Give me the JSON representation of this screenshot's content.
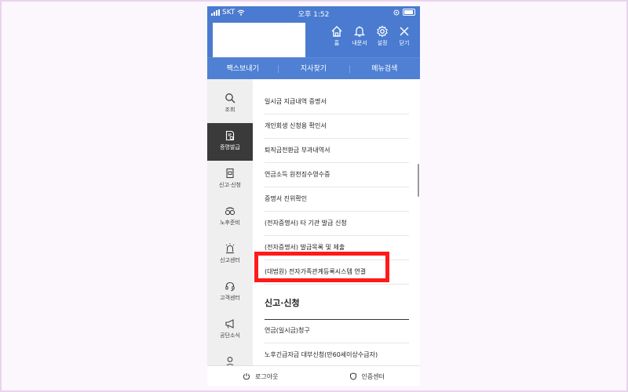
{
  "status_bar": {
    "carrier": "SKT",
    "time": "오후 1:52"
  },
  "header": {
    "buttons": [
      {
        "icon": "home-icon",
        "label": "홈"
      },
      {
        "icon": "bell-icon",
        "label": "내문서"
      },
      {
        "icon": "gear-icon",
        "label": "설정"
      },
      {
        "icon": "close-icon",
        "label": "닫기"
      }
    ]
  },
  "subnav": {
    "tabs": [
      "팩스보내기",
      "지사찾기",
      "메뉴검색"
    ]
  },
  "sidebar": {
    "items": [
      {
        "icon": "search-icon",
        "label": "조회"
      },
      {
        "icon": "certificate-icon",
        "label": "증명발급"
      },
      {
        "icon": "document-icon",
        "label": "신고·신청"
      },
      {
        "icon": "glasses-icon",
        "label": "노후준비"
      },
      {
        "icon": "alarm-light-icon",
        "label": "신고센터"
      },
      {
        "icon": "headset-icon",
        "label": "고객센터"
      },
      {
        "icon": "megaphone-icon",
        "label": "공단소식"
      },
      {
        "icon": "person-icon",
        "label": ""
      }
    ]
  },
  "content": {
    "certificate_items": [
      "일시금 지급내역 증명서",
      "개인회생 신청용 확인서",
      "퇴직금전환금 부과내역서",
      "연금소득 원천징수영수증",
      "증명서 진위확인",
      "(전자증명서) 타 기관 발급 신청",
      "(전자증명서) 발급목록 및 제출",
      "(대법원) 전자가족관계등록시스템 연결"
    ],
    "section_title": "신고·신청",
    "application_items": [
      "연금(일시금)청구",
      "노후긴급자금 대부신청(만60세이상수급자)"
    ]
  },
  "footer": {
    "logout_label": "로그아웃",
    "cert_center_label": "인증센터"
  },
  "colors": {
    "header_blue": "#4a7bd0",
    "sidebar_active": "#3a3a3a",
    "highlight_red": "#ff1a1a"
  }
}
